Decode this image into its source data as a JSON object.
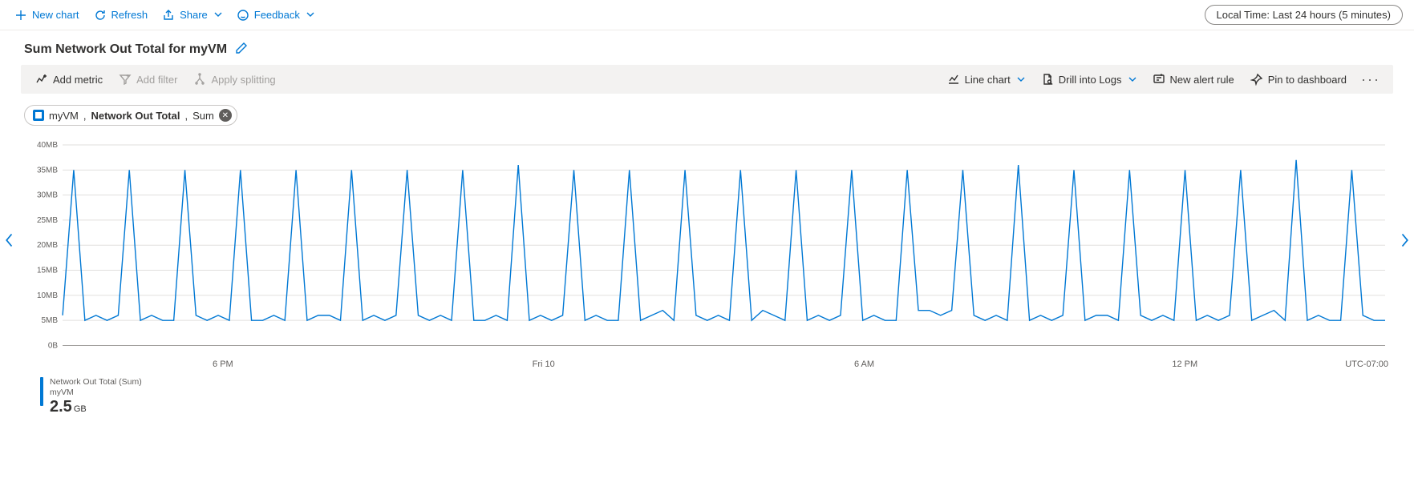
{
  "top": {
    "new_chart": "New chart",
    "refresh": "Refresh",
    "share": "Share",
    "feedback": "Feedback",
    "time_range": "Local Time: Last 24 hours (5 minutes)"
  },
  "title": "Sum Network Out Total for myVM",
  "chart_toolbar": {
    "add_metric": "Add metric",
    "add_filter": "Add filter",
    "apply_splitting": "Apply splitting",
    "chart_type": "Line chart",
    "drill_logs": "Drill into Logs",
    "new_alert": "New alert rule",
    "pin": "Pin to dashboard"
  },
  "metric_pill": {
    "resource": "myVM",
    "metric": "Network Out Total",
    "aggregation": "Sum"
  },
  "timezone": "UTC-07:00",
  "legend": {
    "line1": "Network Out Total (Sum)",
    "line2": "myVM",
    "value": "2.5",
    "unit": "GB"
  },
  "chart_data": {
    "type": "line",
    "title": "Sum Network Out Total for myVM",
    "xlabel": "",
    "ylabel": "",
    "y_ticks": [
      "0B",
      "5MB",
      "10MB",
      "15MB",
      "20MB",
      "25MB",
      "30MB",
      "35MB",
      "40MB"
    ],
    "ylim": [
      0,
      40
    ],
    "x_ticks": [
      "6 PM",
      "Fri 10",
      "6 AM",
      "12 PM"
    ],
    "values": [
      6,
      35,
      5,
      6,
      5,
      6,
      35,
      5,
      6,
      5,
      5,
      35,
      6,
      5,
      6,
      5,
      35,
      5,
      5,
      6,
      5,
      35,
      5,
      6,
      6,
      5,
      35,
      5,
      6,
      5,
      6,
      35,
      6,
      5,
      6,
      5,
      35,
      5,
      5,
      6,
      5,
      36,
      5,
      6,
      5,
      6,
      35,
      5,
      6,
      5,
      5,
      35,
      5,
      6,
      7,
      5,
      35,
      6,
      5,
      6,
      5,
      35,
      5,
      7,
      6,
      5,
      35,
      5,
      6,
      5,
      6,
      35,
      5,
      6,
      5,
      5,
      35,
      7,
      7,
      6,
      7,
      35,
      6,
      5,
      6,
      5,
      36,
      5,
      6,
      5,
      6,
      35,
      5,
      6,
      6,
      5,
      35,
      6,
      5,
      6,
      5,
      35,
      5,
      6,
      5,
      6,
      35,
      5,
      6,
      7,
      5,
      37,
      5,
      6,
      5,
      5,
      35,
      6,
      5,
      5
    ]
  }
}
